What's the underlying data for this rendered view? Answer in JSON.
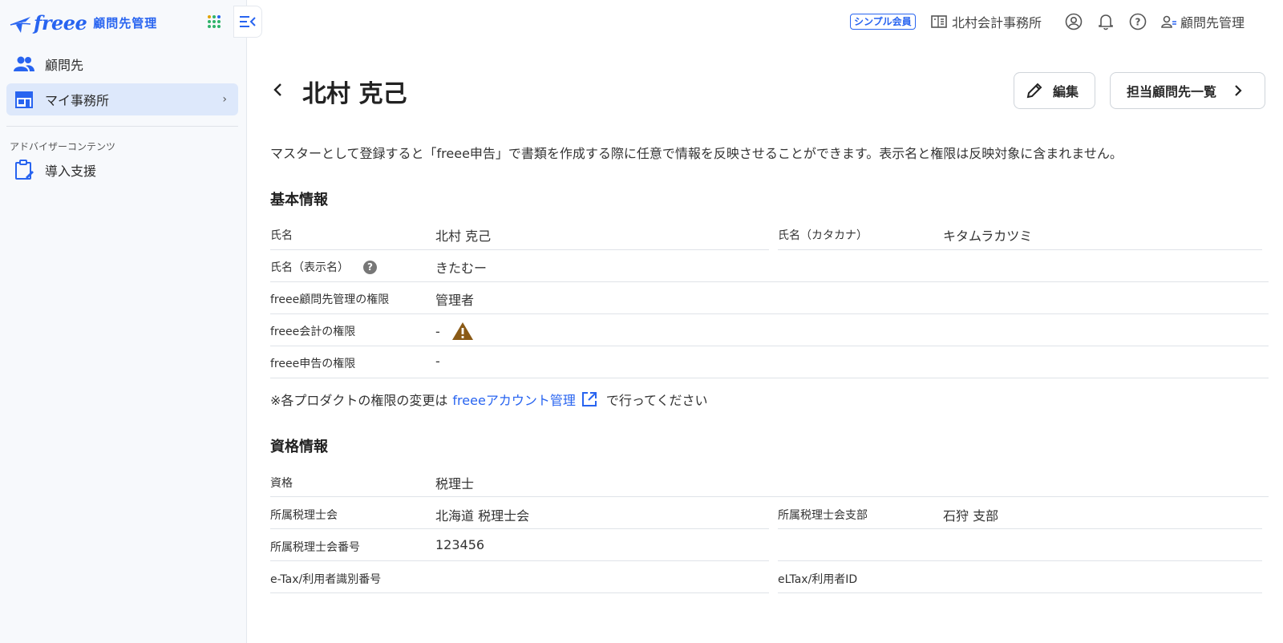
{
  "sidebar": {
    "logo": "freee",
    "product": "顧問先管理",
    "items": [
      {
        "label": "顧問先"
      },
      {
        "label": "マイ事務所"
      }
    ],
    "section": "アドバイザーコンテンツ",
    "section_items": [
      {
        "label": "導入支援"
      }
    ]
  },
  "topbar": {
    "plan_badge": "シンプル会員",
    "office": "北村会計事務所",
    "user_menu": "顧問先管理"
  },
  "page": {
    "title": "北村 克己",
    "edit_button": "編集",
    "clients_button": "担当顧問先一覧",
    "description": "マスターとして登録すると「freee申告」で書類を作成する際に任意で情報を反映させることができます。表示名と権限は反映対象に含まれません。"
  },
  "basic": {
    "title": "基本情報",
    "name_label": "氏名",
    "name_value": "北村 克己",
    "kana_label": "氏名（カタカナ）",
    "kana_value": "キタムラカツミ",
    "display_label": "氏名（表示名）",
    "display_value": "きたむー",
    "help_glyph": "?",
    "perm_advisor_label": "freee顧問先管理の権限",
    "perm_advisor_value": "管理者",
    "perm_accounting_label": "freee会計の権限",
    "perm_accounting_value": "-",
    "perm_tax_label": "freee申告の権限",
    "perm_tax_value": "-",
    "note_prefix": "※各プロダクトの権限の変更は",
    "note_link": "freeeアカウント管理",
    "note_suffix": "で行ってください"
  },
  "qualification": {
    "title": "資格情報",
    "qual_label": "資格",
    "qual_value": "税理士",
    "assoc_label": "所属税理士会",
    "assoc_value": "北海道 税理士会",
    "branch_label": "所属税理士会支部",
    "branch_value": "石狩 支部",
    "number_label": "所属税理士会番号",
    "number_value": "123456",
    "etax_label": "e-Tax/利用者識別番号",
    "eltax_label": "eLTax/利用者ID"
  },
  "colors": {
    "accent": "#2864f0",
    "warning": "#8a5a16"
  }
}
